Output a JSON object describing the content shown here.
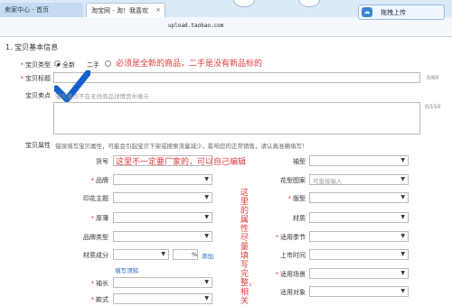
{
  "browser": {
    "tab1_label": "卖家中心 - 首页",
    "tab2_label": "淘宝网 - 淘！我喜欢",
    "tab2_close": "×",
    "url": "upload.taobao.com",
    "cloud_button": "拖拽上传"
  },
  "form": {
    "section_title": "1. 宝贝基本信息",
    "type_label": "宝贝类型",
    "type_options": [
      "全新",
      "二手"
    ],
    "title_label": "宝贝标题",
    "title_counter": "0/60",
    "selling_label": "宝贝卖点",
    "selling_placeholder": "宝贝卖点不在无线商品详情页中展示",
    "selling_counter": "0/150",
    "attr_label": "宝贝属性",
    "attr_hint": "错误填写宝贝属性，可能会引起宝贝下架或搜索流量减少，影响您的正常销售，请认真准确填写！",
    "attrs_left": [
      {
        "label": "货号",
        "required": false
      },
      {
        "label": "品牌",
        "required": true
      },
      {
        "label": "印花主题",
        "required": false
      },
      {
        "label": "厚薄",
        "required": true
      },
      {
        "label": "品牌类型",
        "required": false
      },
      {
        "label": "材质成分",
        "required": false
      },
      {
        "label": "袖长",
        "required": true
      },
      {
        "label": "款式",
        "required": true
      }
    ],
    "attrs_right": [
      {
        "label": "袖型",
        "required": false
      },
      {
        "label": "花型图案",
        "required": false
      },
      {
        "label": "版型",
        "required": true
      },
      {
        "label": "材质",
        "required": false
      },
      {
        "label": "适用季节",
        "required": true
      },
      {
        "label": "上市时间",
        "required": false
      },
      {
        "label": "适用场景",
        "required": true
      },
      {
        "label": "适用对象",
        "required": false
      }
    ],
    "pattern_placeholder": "可直接输入",
    "percent_sign": "%",
    "add_link": "添加",
    "fill_link": "填写须知"
  },
  "annotations": {
    "new_vs_used": "必须是全新的商品，二手是没有新品标的",
    "article_no": "这里不一定要厂家的，可以自己编辑",
    "attributes_vertical": "这里的属性尽量填写完整，相关"
  },
  "colors": {
    "annotation_red": "#e4393c",
    "check_blue": "#1560c9",
    "link_blue": "#2a66c5"
  }
}
